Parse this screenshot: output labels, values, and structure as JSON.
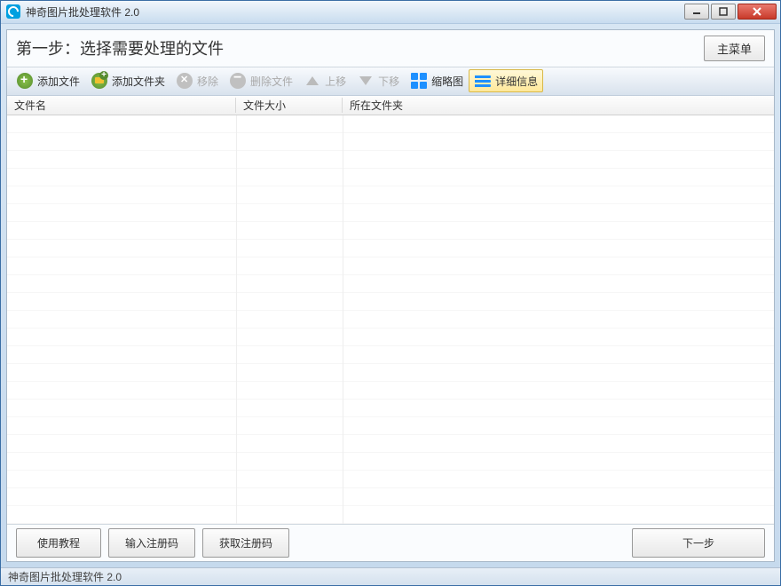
{
  "window": {
    "title": "神奇图片批处理软件 2.0"
  },
  "step": {
    "title": "第一步：选择需要处理的文件",
    "main_menu": "主菜单"
  },
  "toolbar": {
    "add_file": "添加文件",
    "add_folder": "添加文件夹",
    "remove": "移除",
    "delete_file": "删除文件",
    "move_up": "上移",
    "move_down": "下移",
    "thumbnail": "缩略图",
    "details": "详细信息"
  },
  "columns": {
    "name": "文件名",
    "size": "文件大小",
    "folder": "所在文件夹"
  },
  "bottom": {
    "tutorial": "使用教程",
    "enter_key": "输入注册码",
    "get_key": "获取注册码",
    "next": "下一步"
  },
  "status": {
    "text": "神奇图片批处理软件 2.0"
  }
}
